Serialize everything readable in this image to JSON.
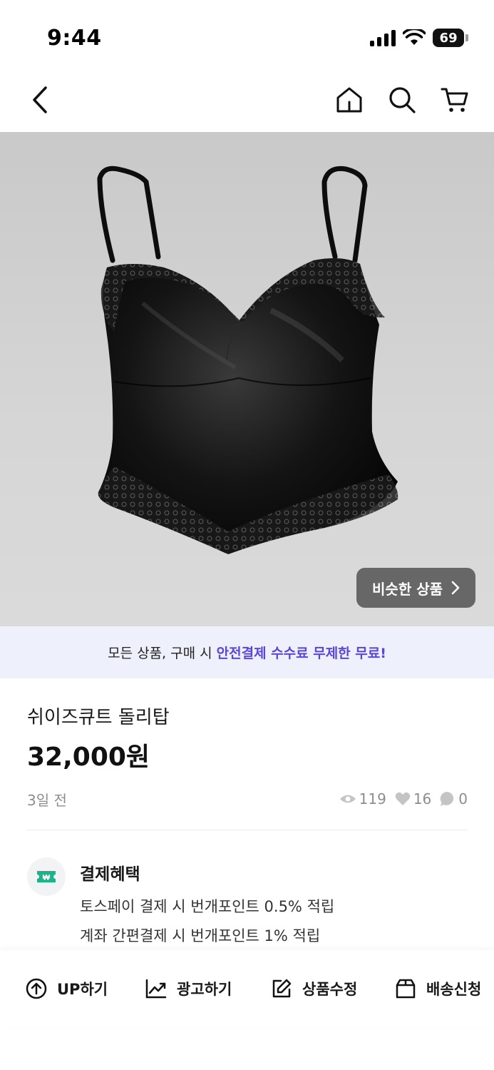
{
  "status_bar": {
    "time": "9:44",
    "battery": "69"
  },
  "product_image": {
    "similar_button": "비슷한 상품"
  },
  "promo": {
    "prefix": "모든 상품, 구매 시",
    "highlight": "안전결제 수수료 무제한 무료!",
    "highlight_color": "#5b47d6"
  },
  "product": {
    "title": "쉬이즈큐트 돌리탑",
    "price": "32,000원",
    "posted": "3일 전",
    "views": "119",
    "likes": "16",
    "chats": "0"
  },
  "payment_benefits": {
    "title": "결제혜택",
    "lines": [
      "토스페이 결제 시 번개포인트 0.5% 적립",
      "계좌 간편결제 시 번개포인트 1% 적립"
    ],
    "icon_color": "#1db38a"
  },
  "actions": [
    {
      "label": "UP하기",
      "icon": "arrow-up-circle-icon"
    },
    {
      "label": "광고하기",
      "icon": "trend-chart-icon"
    },
    {
      "label": "상품수정",
      "icon": "edit-icon"
    },
    {
      "label": "배송신청",
      "icon": "box-icon"
    }
  ]
}
